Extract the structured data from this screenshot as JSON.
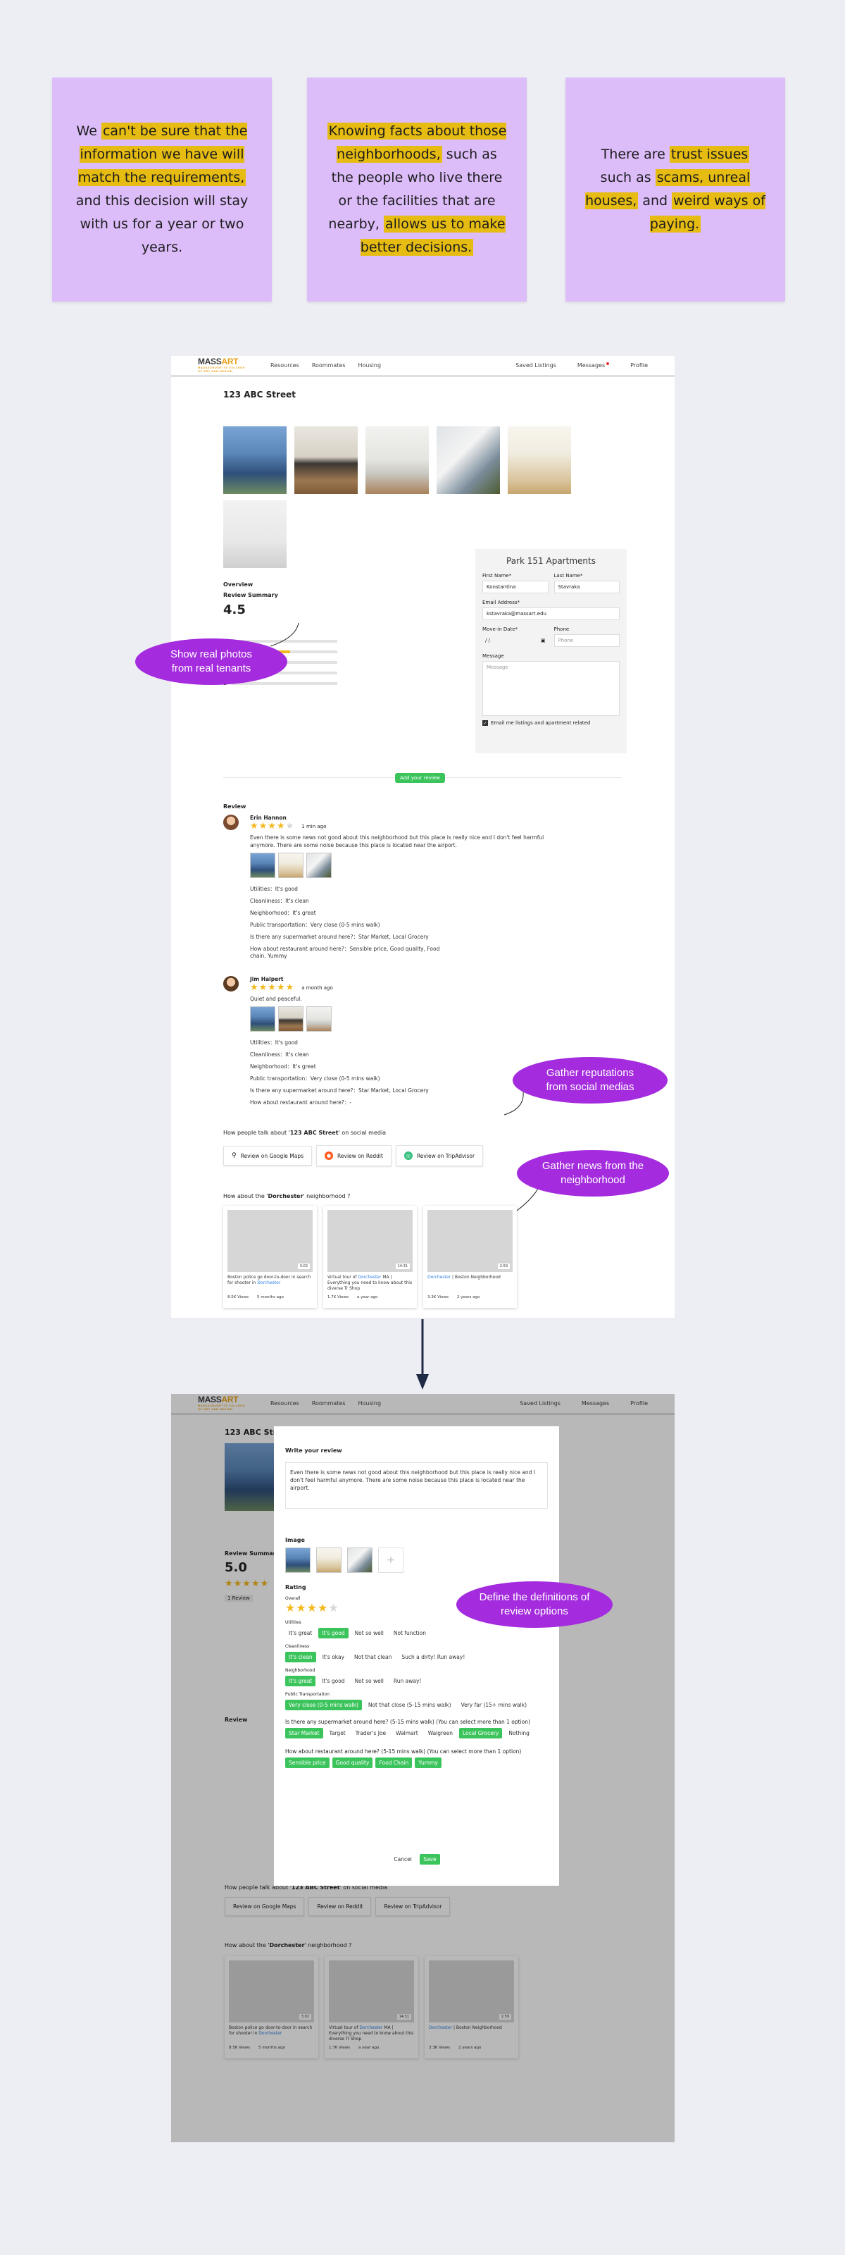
{
  "quotes": [
    {
      "pre": "We ",
      "h1": "can't be sure that the information we have will match the requirements,",
      "post": " and this decision will stay with us for a year or two years."
    },
    {
      "h1": "Knowing facts about those neighborhoods,",
      "mid": " such as the people who live there or the facilities that are nearby, ",
      "h2": "allows us to make better decisions."
    },
    {
      "pre": "There are ",
      "h1": "trust issues",
      "mid": " such as ",
      "h2": "scams, unreal houses,",
      "mid2": " and ",
      "h3": "weird ways of paying."
    }
  ],
  "nav": {
    "logo_main_1": "MASS",
    "logo_main_2": "ART",
    "logo_sub_1": "MASSACHUSETTS COLLEGE",
    "logo_sub_2": "OF ART AND DESIGN",
    "links": [
      "Resources",
      "Roommates",
      "Housing"
    ],
    "right": [
      "Saved Listings",
      "Messages",
      "Profile"
    ]
  },
  "listing": {
    "title": "123 ABC Street",
    "overview": "Overview",
    "review_summary": "Review Summary",
    "rating": "4.5",
    "rating_modal": "5.0",
    "review_count_badge": "1 Review",
    "bar_labels": [
      "5",
      "4",
      "3",
      "2",
      "1"
    ],
    "bar_fill": [
      0.0,
      0.55,
      0.0,
      0.0,
      0.0
    ]
  },
  "form": {
    "title": "Park 151 Apartments",
    "first_label": "First Name*",
    "first_value": "Konstantina",
    "last_label": "Last Name*",
    "last_value": "Stavraka",
    "email_label": "Email Address*",
    "email_value": "kstavraka@massart.edu",
    "movein_label": "Move-in Date*",
    "movein_value": "/     /",
    "phone_label": "Phone",
    "phone_placeholder": "Phone",
    "message_label": "Message",
    "message_placeholder": "Message",
    "checkbox_label": "Email me listings and apartment related"
  },
  "add_review": "Add your review",
  "review_heading": "Review",
  "reviews": [
    {
      "name": "Erin Hannon",
      "time": "1 min ago",
      "text": "Even there is some news not good about this neighborhood but this place is really nice and I don't feel harmful anymore. There are some noise because this place is located near the airport.",
      "lines": [
        "Utilities：It's good",
        "Cleanliness：It's clean",
        "Neighborhood：It's great",
        "Public transportation：Very close (0-5 mins walk)",
        "Is there any supermarket around here?：Star Market, Local Grocery",
        "How about restaurant around here?：Sensible price, Good quality, Food chain, Yummy"
      ]
    },
    {
      "name": "Jim Halpert",
      "time": "a month ago",
      "text": "Quiet and peaceful.",
      "lines": [
        "Utilities：It's good",
        "Cleanliness：It's clean",
        "Neighborhood：It's great",
        "Public transportation：Very close (0-5 mins walk)",
        "Is there any supermarket around here?：Star Market, Local Grocery",
        "How about restaurant around here?：-"
      ]
    }
  ],
  "social": {
    "heading_pre": "How people talk about '",
    "heading_bold": "123 ABC Street",
    "heading_post": "' on social media",
    "buttons": [
      "Review on Google Maps",
      "Review on Reddit",
      "Review on TripAdvisor"
    ]
  },
  "news": {
    "heading_pre": "How about the '",
    "heading_bold": "Dorchester",
    "heading_post": "' neighborhood ?",
    "cards": [
      {
        "dur": "3:02",
        "d1": "Boston police go door-to-door in search for shooter in ",
        "d2": "Dorchester",
        "d3": "",
        "views": "8.5K Views",
        "ago": "5 months ago"
      },
      {
        "dur": "14:31",
        "d1": "Virtual tour of ",
        "d2": "Dorchester",
        "d3": " MA | Everything you need to know about this diverse Tr Shop",
        "views": "1.7K Views",
        "ago": "a year ago"
      },
      {
        "dur": "2:59",
        "d1": "",
        "d2": "Dorchester",
        "d3": " | Boston Neighborhood",
        "views": "3.3K Views",
        "ago": "2 years ago"
      }
    ]
  },
  "annotations": {
    "photos": "Show real photos from real tenants",
    "reputation": "Gather reputations from social medias",
    "news": "Gather news from the neighborhood",
    "definitions": "Define the definitions of review options"
  },
  "modal": {
    "title": "Write your review",
    "text": "Even there is some news not good about this neighborhood but this place is really nice and I don't feel harmful anymore. There are some noise because this place is located near the airport.",
    "image_label": "Image",
    "add_image": "+",
    "rating_label": "Rating",
    "overall": "Overall",
    "groups": [
      {
        "label": "Utilities",
        "opts": [
          "It's great",
          "It's good",
          "Not so well",
          "Not function"
        ],
        "sel": [
          1
        ]
      },
      {
        "label": "Cleanliness",
        "opts": [
          "It's clean",
          "It's okay",
          "Not that clean",
          "Such a dirty! Run away!"
        ],
        "sel": [
          0
        ]
      },
      {
        "label": "Neighborhood",
        "opts": [
          "It's great",
          "It's good",
          "Not so well",
          "Run away!"
        ],
        "sel": [
          0
        ]
      },
      {
        "label": "Public Transportation",
        "opts": [
          "Very close (0-5 mins walk)",
          "Not that close (5-15 mins walk)",
          "Very far (15+ mins walk)"
        ],
        "sel": [
          0
        ]
      }
    ],
    "supermarket_q": "Is there any supermarket around here? (5-15 mins walk) (You can select more than 1 option)",
    "supermarket_opts": [
      "Star Market",
      "Target",
      "Trader's Joe",
      "Walmart",
      "Walgreen",
      "Local Grocery",
      "Nothing"
    ],
    "supermarket_sel": [
      0,
      5
    ],
    "restaurant_q": "How about restaurant around here? (5-15 mins walk) (You can select more than 1 option)",
    "restaurant_opts": [
      "Sensible price",
      "Good quality",
      "Food Chain",
      "Yummy"
    ],
    "restaurant_sel": [
      0,
      1,
      2,
      3
    ],
    "cancel": "Cancel",
    "save": "Save"
  },
  "colors": {
    "highlight": "#e6bc12",
    "card": "#dcbcf9",
    "bubble": "#a42cde",
    "green": "#3cc45c",
    "star": "#f3b81c",
    "arrow": "#1f2a44"
  }
}
